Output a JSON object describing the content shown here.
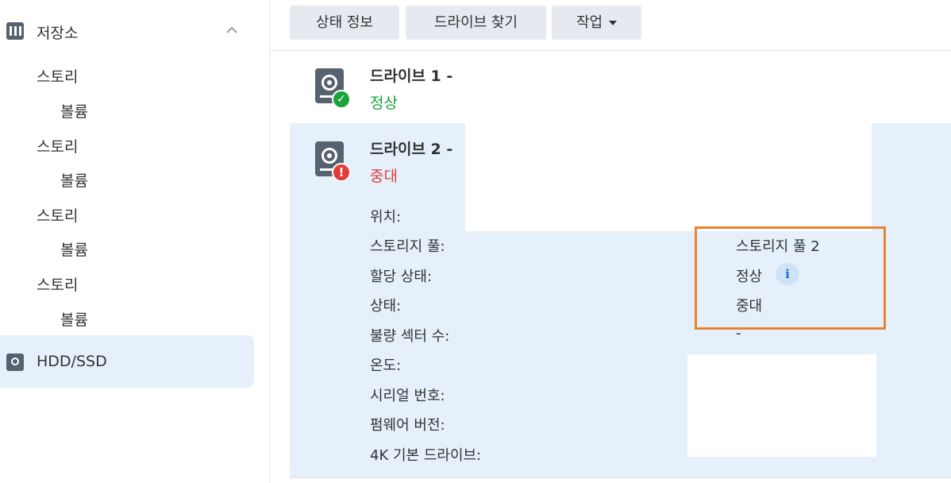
{
  "sidebar": {
    "storage_label": "저장소",
    "items": [
      {
        "label": "스토리"
      },
      {
        "label": "볼륨"
      },
      {
        "label": "스토리"
      },
      {
        "label": "볼륨"
      },
      {
        "label": "스토리"
      },
      {
        "label": "볼륨"
      },
      {
        "label": "스토리"
      },
      {
        "label": "볼륨"
      }
    ],
    "hdd_label": "HDD/SSD"
  },
  "toolbar": {
    "status_info": "상태 정보",
    "find_drive": "드라이브 찾기",
    "action": "작업"
  },
  "drives": [
    {
      "name": "드라이브 1 -",
      "status": "정상",
      "status_color": "#1aa33a"
    },
    {
      "name": "드라이브 2 -",
      "status": "중대",
      "status_color": "#e23b3b"
    }
  ],
  "details": {
    "labels": {
      "location": "위치:",
      "storage_pool": "스토리지 풀:",
      "allocation_status": "할당 상태:",
      "status": "상태:",
      "bad_sector": "불량 섹터 수:",
      "temperature": "온도:",
      "serial": "시리얼 번호:",
      "firmware": "펌웨어 버전:",
      "native_4k": "4K 기본 드라이브:"
    },
    "values": {
      "storage_pool": "스토리지 풀 2",
      "allocation_status": "정상",
      "status": "중대",
      "bad_sector": "-"
    }
  },
  "colors": {
    "accent_highlight": "#e8842e",
    "selected_bg": "#e6f0fb",
    "ok": "#1aa33a",
    "critical": "#e23b3b"
  }
}
